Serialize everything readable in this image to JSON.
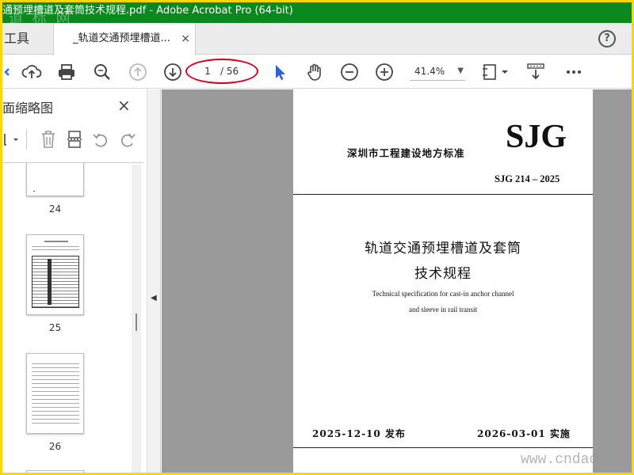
{
  "window": {
    "title": "通预埋槽道及套筒技术规程.pdf - Adobe Acrobat Pro (64-bit)",
    "watermark_top": "道 标 网",
    "accent": "#0a8a1e",
    "frame_color": "#ffd700"
  },
  "tabs": {
    "tools_label": "工具",
    "doc_label": "_轨道交通预埋槽道...",
    "close_glyph": "×",
    "help_glyph": "?"
  },
  "toolbar": {
    "page_current": "1",
    "page_total": "/ 56",
    "zoom": "41.4%",
    "annotation_color": "#d9001b"
  },
  "left_panel": {
    "title": "面缩略图",
    "close_glyph": "×",
    "thumbnails": [
      {
        "number": "24"
      },
      {
        "number": "25"
      },
      {
        "number": "26"
      }
    ]
  },
  "document_page": {
    "org": "深圳市工程建设地方标准",
    "sjg": "SJG",
    "code": "SJG 214 – 2025",
    "title_line1": "轨道交通预埋槽道及套筒",
    "title_line2": "技术规程",
    "english_line1": "Technical specification for cast-in anchor channel",
    "english_line2": "and sleeve in rail transit",
    "issue_date": "2025-12-10  发布",
    "effective_date": "2026-03-01  实施"
  },
  "watermark_bottom": "www.cndao."
}
